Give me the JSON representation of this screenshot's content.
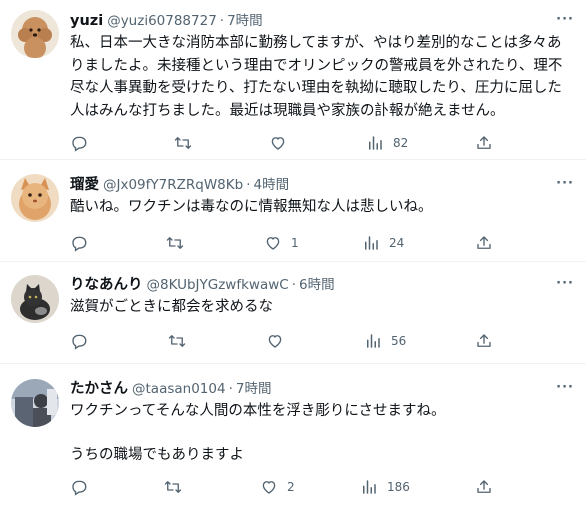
{
  "tweets": [
    {
      "name": "yuzi",
      "handle": "@yuzi60788727",
      "dot": "·",
      "time": "7時間",
      "text": "私、日本一大きな消防本部に勤務してますが、やはり差別的なことは多々ありましたよ。未接種という理由でオリンピックの警戒員を外されたり、理不尽な人事異動を受けたり、打たない理由を執拗に聴取したり、圧力に屈した人はみんな打ちました。最近は現職員や家族の訃報が絶えません。",
      "replies": "",
      "retweets": "",
      "likes": "",
      "views": "82",
      "avatar_color": "#d3a37b",
      "avatar_icon": "poodle-avatar"
    },
    {
      "name": "瑠愛",
      "handle": "@Jx09fY7RZRqW8Kb",
      "dot": "·",
      "time": "4時間",
      "text": "酷いね。ワクチンは毒なのに情報無知な人は悲しいね。",
      "replies": "",
      "retweets": "",
      "likes": "1",
      "views": "24",
      "avatar_color": "#e0a46a",
      "avatar_icon": "cat-avatar"
    },
    {
      "name": "りなあんり",
      "handle": "@8KUbJYGzwfkwawC",
      "dot": "·",
      "time": "6時間",
      "text": "滋賀がごときに都会を求めるな",
      "replies": "",
      "retweets": "",
      "likes": "",
      "views": "56",
      "avatar_color": "#d8d2c8",
      "avatar_icon": "black-cat-avatar"
    },
    {
      "name": "たかさん",
      "handle": "@taasan0104",
      "dot": "·",
      "time": "7時間",
      "text": "ワクチンってそんな人間の本性を浮き彫りにさせますね。\n\nうちの職場でもありますよ",
      "replies": "",
      "retweets": "",
      "likes": "2",
      "views": "186",
      "avatar_color": "#8a95a8",
      "avatar_icon": "photo-avatar"
    }
  ],
  "more_label": "···",
  "icons": {
    "reply": "reply-icon",
    "retweet": "retweet-icon",
    "like": "like-icon",
    "views": "views-icon",
    "share": "share-icon"
  },
  "colors": {
    "text": "#0f1419",
    "muted": "#536471",
    "divider": "#eff3f4"
  }
}
